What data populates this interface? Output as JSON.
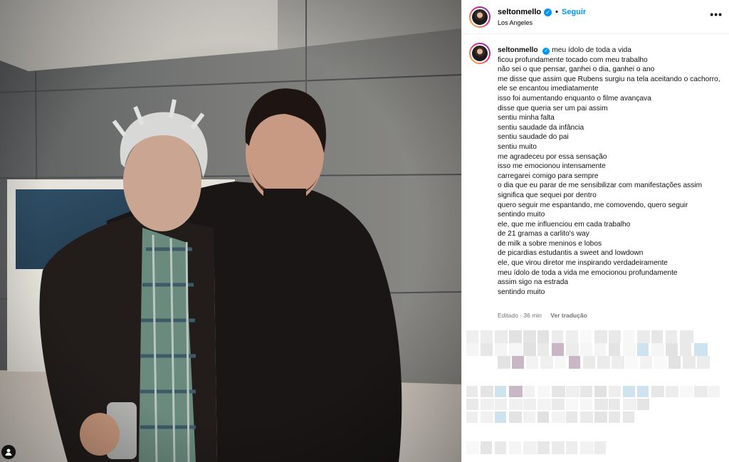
{
  "post": {
    "username": "seltonmello",
    "verified_mark": "✓",
    "separator": "•",
    "follow_label": "Seguir",
    "location": "Los Angeles",
    "more_label": "•••"
  },
  "caption": {
    "username": "seltonmello",
    "first_line": "meu ídolo de toda a vida",
    "lines": [
      "ficou profundamente tocado com meu trabalho",
      "não sei o que pensar, ganhei o dia, ganhei o ano",
      "me disse que assim que Rubens surgiu na tela aceitando o cachorro, ele se encantou imediatamente",
      "isso foi aumentando enquanto o filme avançava",
      "disse que queria ser um pai assim",
      "sentiu minha falta",
      "sentiu saudade da infância",
      "sentiu saudade do pai",
      "sentiu muito",
      "me agradeceu por essa sensação",
      "isso me emocionou intensamente",
      "carregarei comigo para sempre",
      "o dia que eu parar de me sensibilizar com manifestações assim",
      "significa que sequei por dentro",
      "quero seguir me espantando, me comovendo, quero seguir",
      "sentindo muito",
      "ele, que me influenciou em cada trabalho",
      "de 21 gramas a carlito's way",
      "de milk a sobre meninos e lobos",
      "de picardias estudantis a sweet and lowdown",
      "ele, que virou diretor me inspirando verdadeiramente",
      "meu ídolo de toda a vida me emocionou profundamente",
      "assim sigo na estrada",
      "sentindo muito"
    ],
    "edited": "Editado · 36 min",
    "translate_label": "Ver tradução"
  },
  "icons": {
    "more": "more-horizontal-icon",
    "verified": "verified-badge-icon",
    "tag": "user-tag-icon"
  },
  "colors": {
    "accent": "#0095f6",
    "muted": "#737373",
    "border": "#efefef"
  }
}
